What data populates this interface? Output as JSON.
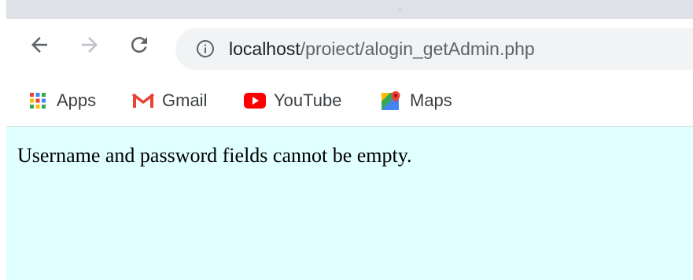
{
  "browser": {
    "address_bar": {
      "host": "localhost",
      "path": "/proiect/alogin_getAdmin.php"
    },
    "bookmarks": [
      {
        "label": "Apps",
        "icon": "apps-grid-icon"
      },
      {
        "label": "Gmail",
        "icon": "gmail-icon"
      },
      {
        "label": "YouTube",
        "icon": "youtube-icon"
      },
      {
        "label": "Maps",
        "icon": "maps-icon"
      }
    ]
  },
  "page": {
    "message": "Username and password fields cannot be empty.",
    "background_color": "#e0ffff"
  }
}
